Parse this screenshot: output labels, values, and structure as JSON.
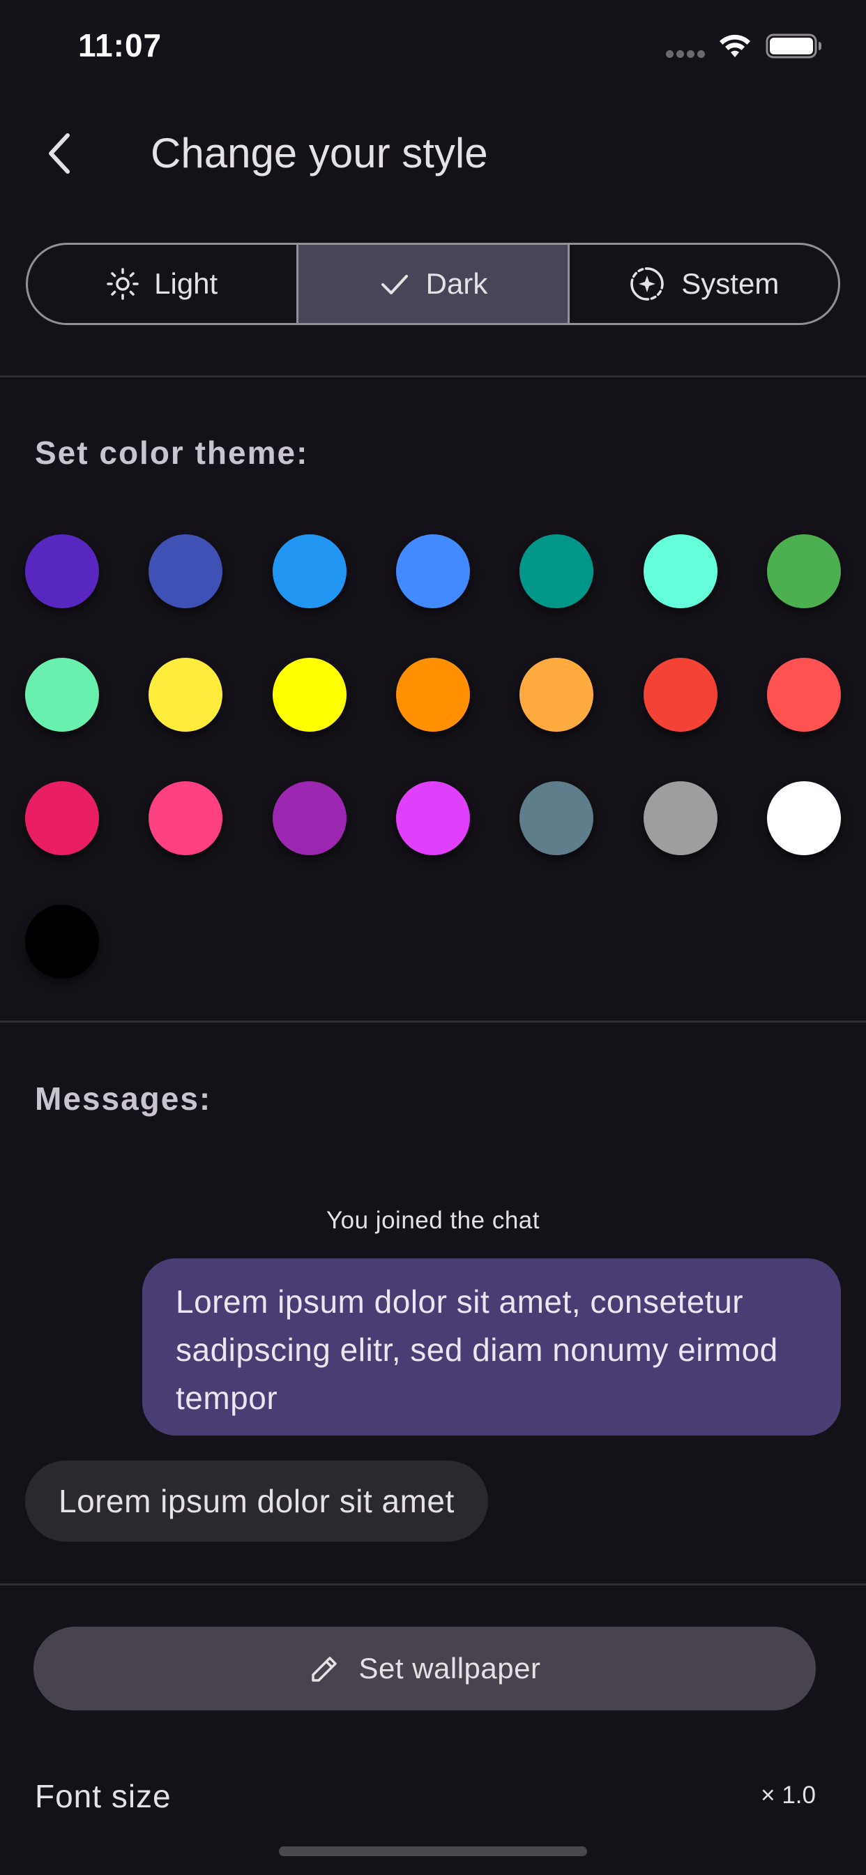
{
  "status_bar": {
    "time": "11:07"
  },
  "app_bar": {
    "title": "Change your style"
  },
  "theme_mode": {
    "options": [
      {
        "label": "Light",
        "icon": "sun-icon",
        "selected": false
      },
      {
        "label": "Dark",
        "icon": "check-icon",
        "selected": true
      },
      {
        "label": "System",
        "icon": "auto-brightness-icon",
        "selected": false
      }
    ]
  },
  "color_theme": {
    "label": "Set color theme:",
    "colors": [
      "#5727BF",
      "#3F51B5",
      "#2196F3",
      "#448AFF",
      "#009688",
      "#64FFDA",
      "#4CAF50",
      "#69F0AE",
      "#FFEB3B",
      "#FFFF00",
      "#FF9100",
      "#FFAB40",
      "#F44336",
      "#FF5252",
      "#E91E63",
      "#FF4081",
      "#9C27B0",
      "#E040FB",
      "#607D8B",
      "#9E9E9E",
      "#FFFFFF",
      "#000000"
    ]
  },
  "messages": {
    "label": "Messages:",
    "system_message": "You joined the chat",
    "outgoing": "Lorem ipsum dolor sit amet, consetetur sadipscing elitr, sed diam nonumy eirmod tempor",
    "incoming": "Lorem ipsum dolor sit amet"
  },
  "wallpaper": {
    "label": "Set wallpaper",
    "icon": "pencil-icon"
  },
  "font_size": {
    "label": "Font size",
    "value": "× 1.0"
  },
  "colors": {
    "background": "#141218",
    "selected_segment": "#4A4458",
    "outgoing_bubble": "#4A3D74",
    "incoming_bubble": "#2B2930",
    "button": "#48434F"
  }
}
